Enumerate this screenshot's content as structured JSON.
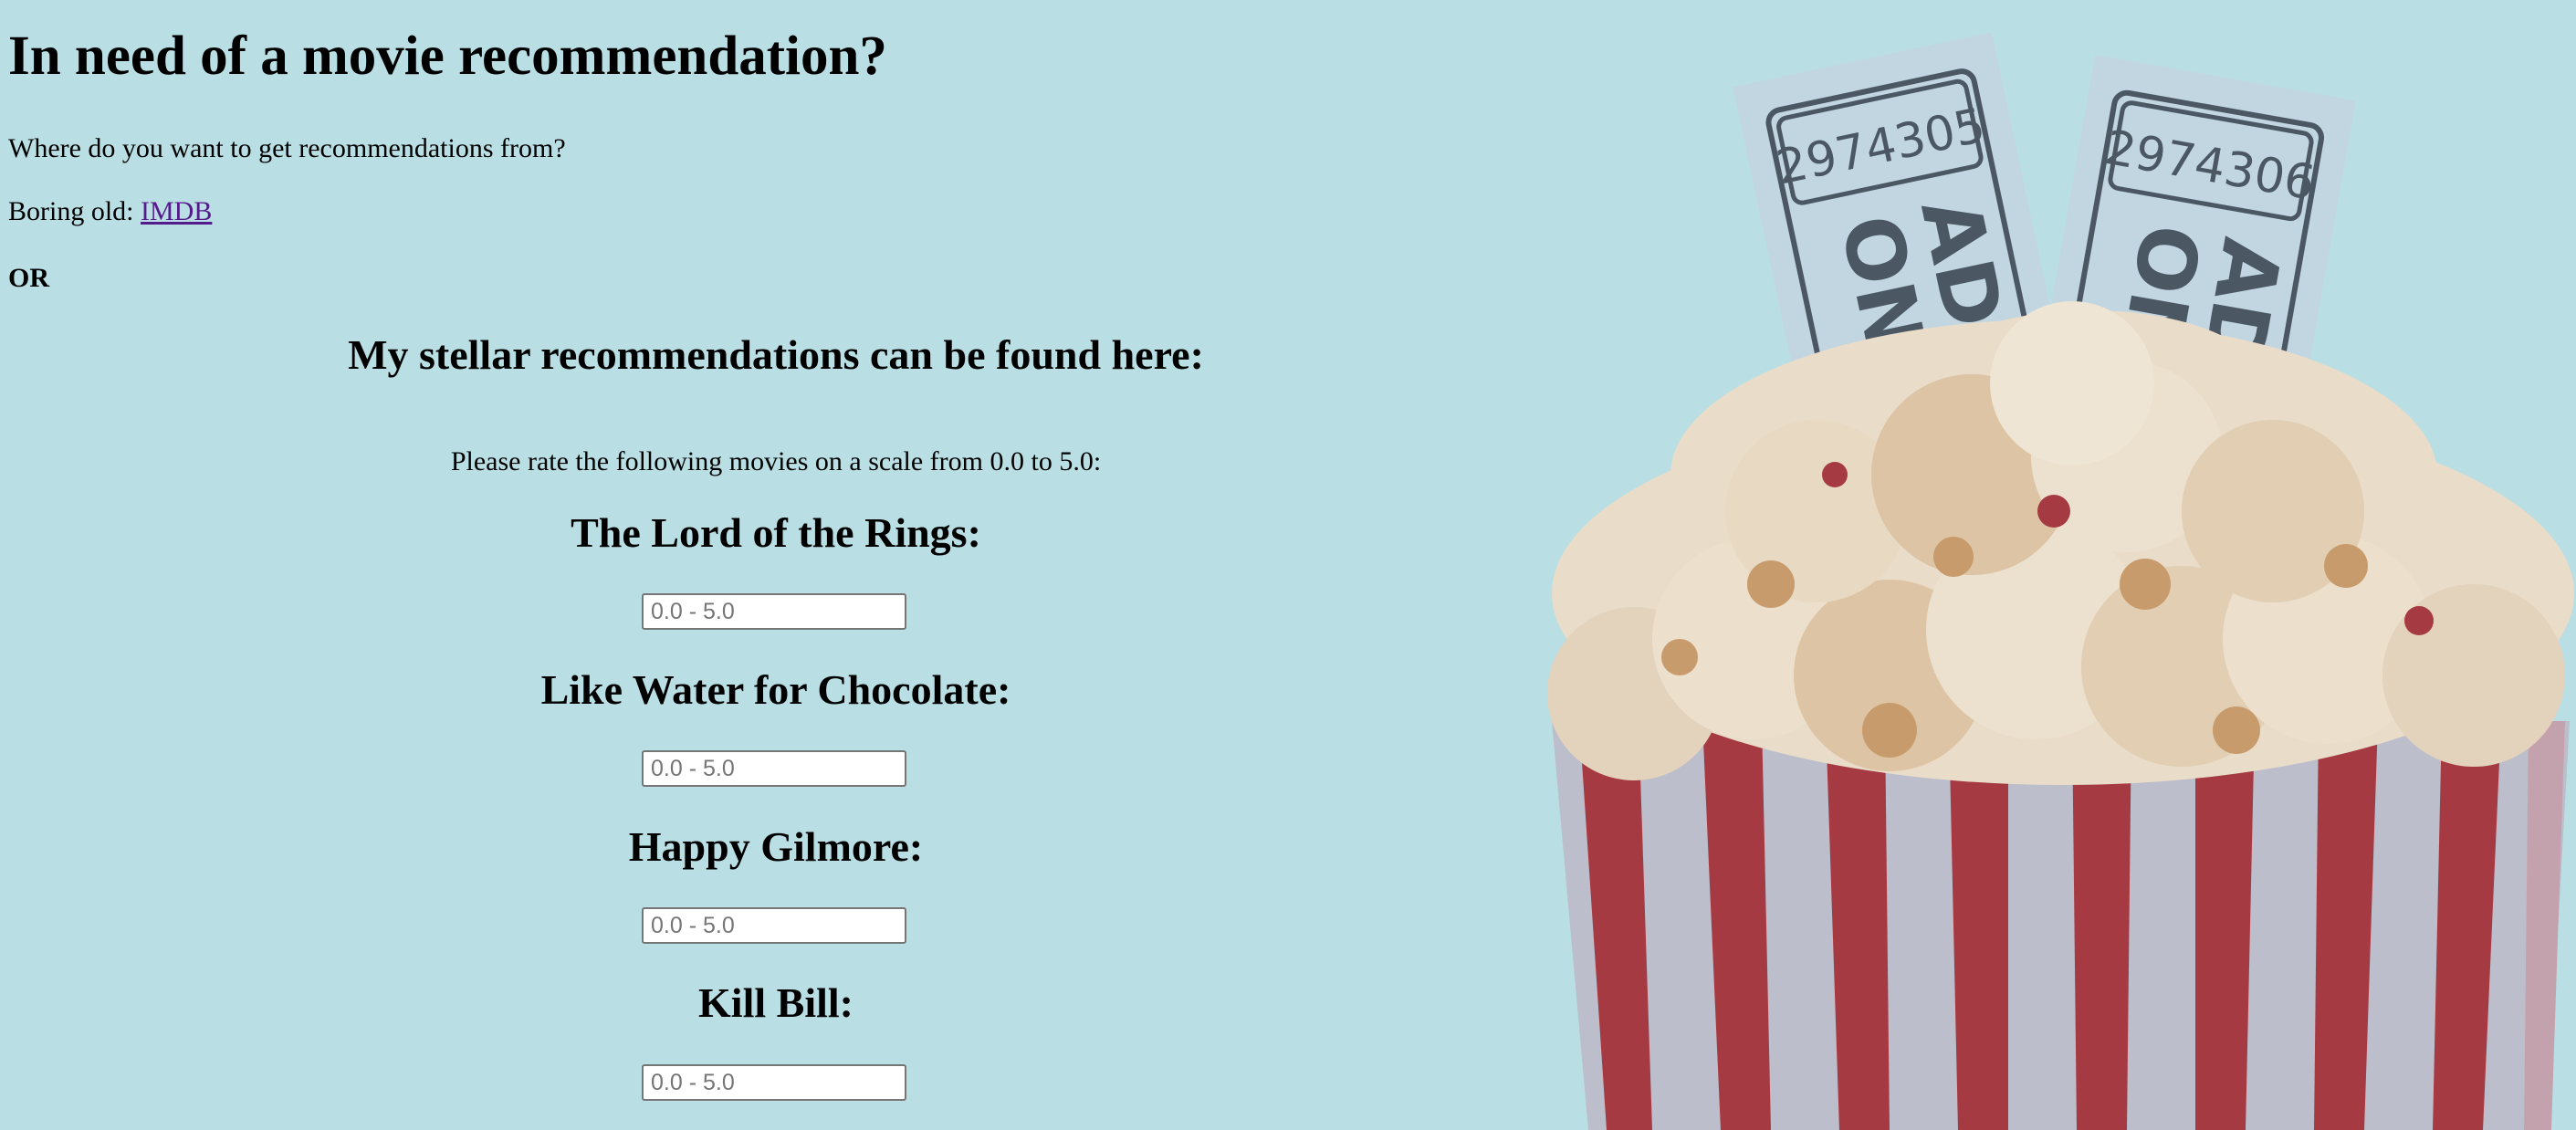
{
  "header": {
    "title": "In need of a movie recommendation?",
    "question": "Where do you want to get recommendations from?",
    "imdb_prefix": "Boring old: ",
    "imdb_link": "IMDB",
    "or_text": "OR"
  },
  "recommendations": {
    "heading": "My stellar recommendations can be found here:",
    "instruction": "Please rate the following movies on a scale from 0.0 to 5.0:",
    "placeholder": "0.0 - 5.0",
    "movies": [
      {
        "title": "The Lord of the Rings:"
      },
      {
        "title": "Like Water for Chocolate:"
      },
      {
        "title": "Happy Gilmore:"
      },
      {
        "title": "Kill Bill:"
      }
    ]
  },
  "illustration": {
    "ticket_left_number": "2974305",
    "ticket_right_number": "2974306",
    "ticket_text_line1": "ADMIT",
    "ticket_text_line2": "ONE",
    "colors": {
      "background": "#b9dfe4",
      "ticket": "#c2d6e2",
      "ticket_ink": "#4b5864",
      "popcorn": "#e9dcc9",
      "popcorn_shadow": "#c79b6b",
      "stripe_red": "#a63a42",
      "stripe_grey": "#bcbecb"
    }
  }
}
